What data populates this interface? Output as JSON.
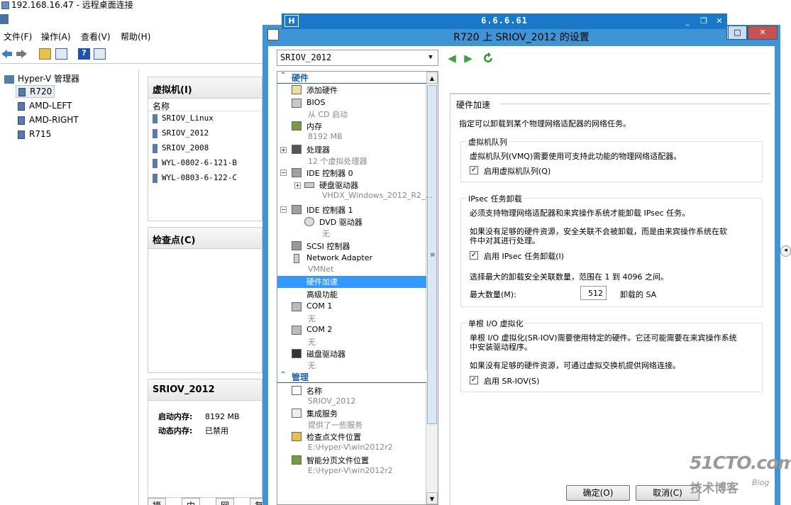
{
  "rdp": {
    "title": "192.168.16.47 - 远程桌面连接",
    "bar_title": "6.6.6.61",
    "pin": "H"
  },
  "hyperv": {
    "menu": [
      "文件(F)",
      "操作(A)",
      "查看(V)",
      "帮助(H)"
    ],
    "help_glyph": "?",
    "tree_root": "Hyper-V 管理器",
    "servers": [
      "R720",
      "AMD-LEFT",
      "AMD-RIGHT",
      "R715"
    ],
    "vm_panel_title": "虚拟机(I)",
    "vm_col_name": "名称",
    "vms": [
      "SRIOV_Linux",
      "SRIOV_2012",
      "SRIOV_2008",
      "WYL-0802-6-121-B",
      "WYL-0803-6-122-C"
    ],
    "checkpoint_title": "检查点(C)",
    "details_title": "SRIOV_2012",
    "details": [
      {
        "label": "启动内存:",
        "value": "8192 MB"
      },
      {
        "label": "动态内存:",
        "value": "已禁用"
      }
    ],
    "detail_tabs": [
      "摘要",
      "内存",
      "网络",
      "复"
    ]
  },
  "dialog": {
    "title": "R720 上 SRIOV_2012 的设置",
    "vm_select": "SRIOV_2012",
    "ctrl": {
      "min": "—",
      "max": "□",
      "close": "✕"
    },
    "sections": {
      "hardware": "硬件",
      "management": "管理"
    },
    "tree": {
      "add_hw": "添加硬件",
      "bios": "BIOS",
      "bios_sub": "从 CD 启动",
      "memory": "内存",
      "memory_sub": "8192 MB",
      "processor": "处理器",
      "processor_sub": "12 个虚拟处理器",
      "ide0": "IDE 控制器 0",
      "hdd": "硬盘驱动器",
      "hdd_sub": "VHDX_Windows_2012_R2_...",
      "ide1": "IDE 控制器 1",
      "dvd": "DVD 驱动器",
      "dvd_sub": "无",
      "scsi": "SCSI 控制器",
      "netadapter": "Network Adapter",
      "netadapter_sub": "VMNet",
      "hwaccel": "硬件加速",
      "advanced": "高级功能",
      "com1": "COM 1",
      "com1_sub": "无",
      "com2": "COM 2",
      "com2_sub": "无",
      "floppy": "磁盘驱动器",
      "floppy_sub": "无",
      "name": "名称",
      "name_sub": "SRIOV_2012",
      "integration": "集成服务",
      "integration_sub": "提供了一些服务",
      "checkpoint_loc": "检查点文件位置",
      "checkpoint_loc_sub": "E:\\Hyper-V\\win2012r2",
      "paging_loc": "智能分页文件位置",
      "paging_loc_sub": "E:\\Hyper-V\\win2012r2"
    },
    "pane": {
      "title": "硬件加速",
      "intro": "指定可以卸载到某个物理网络适配器的网络任务。",
      "vmq_group": "虚拟机队列",
      "vmq_desc": "虚拟机队列(VMQ)需要使用可支持此功能的物理网络适配器。",
      "vmq_check": "启用虚拟机队列(Q)",
      "ipsec_group": "IPsec 任务卸载",
      "ipsec_desc": "必须支持物理网络适配器和来宾操作系统才能卸载 IPsec 任务。",
      "ipsec_desc2a": "如果没有足够的硬件资源，安全关联不会被卸载，而是由来宾操作系统在软",
      "ipsec_desc2b": "件中对其进行处理。",
      "ipsec_check": "启用 IPsec 任务卸载(I)",
      "ipsec_range": "选择最大的卸载安全关联数量，范围在 1 到 4096 之间。",
      "max_label": "最大数量(M):",
      "max_value": "512",
      "max_unit": "卸载的 SA",
      "sriov_group": "单根 I/O 虚拟化",
      "sriov_desc_a": "单根 I/O 虚拟化(SR-IOV)需要使用特定的硬件。它还可能需要在来宾操作系统",
      "sriov_desc_b": "中安装驱动程序。",
      "sriov_desc2": "如果没有足够的硬件资源，可通过虚拟交换机提供网络连接。",
      "sriov_check": "启用 SR-IOV(S)",
      "check_mark": "✓"
    },
    "buttons": {
      "ok": "确定(O)",
      "cancel": "取消(C)"
    }
  },
  "watermark": {
    "site": "51CTO.com",
    "sub": "技术博客",
    "sub2": "Blog"
  }
}
